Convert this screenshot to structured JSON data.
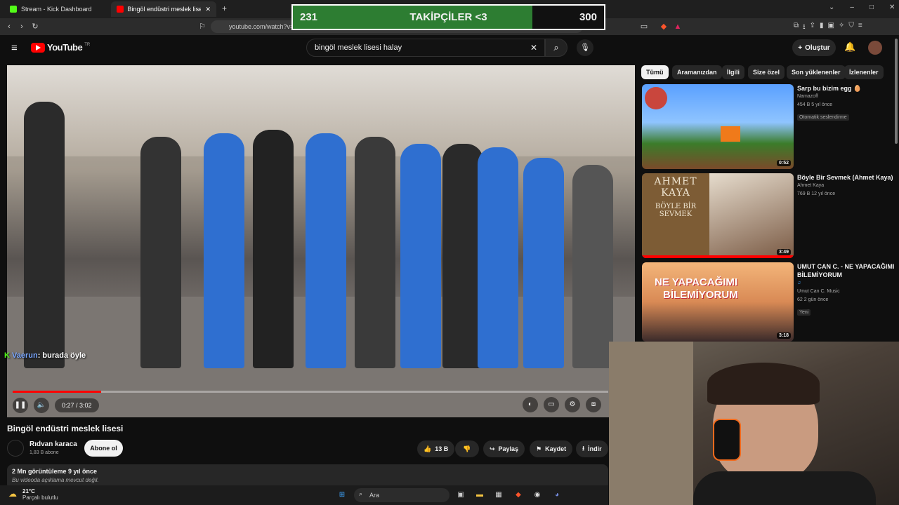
{
  "browser": {
    "tabs": [
      {
        "label": "Stream - Kick Dashboard",
        "color": "#53fc18"
      },
      {
        "label": "Bingöl endüstri meslek lisesi",
        "color": "#ff0000"
      }
    ],
    "url": "youtube.com/watch?v="
  },
  "overlay": {
    "left_count": "231",
    "label": "TAKİPÇİLER <3",
    "right_count": "300",
    "progress": 0.77,
    "fill_color": "#2d7d32"
  },
  "youtube": {
    "logo": "YouTube",
    "region": "TR",
    "search_query": "bingöl meslek lisesi halay",
    "create_label": "Oluştur"
  },
  "video": {
    "chat_user": "Vaerun",
    "chat_message": ": burada öyle",
    "time": "0:27 / 3:02",
    "progress": 0.149,
    "title": "Bingöl endüstri meslek lisesi",
    "channel": "Rıdvan karaca",
    "subscribers": "1,83 B abone",
    "subscribe_label": "Abone ol",
    "likes": "13 B",
    "share_label": "Paylaş",
    "save_label": "Kaydet",
    "download_label": "İndir",
    "stats": "2 Mn görüntüleme  9 yıl önce",
    "description": "Bu videoda açıklama mevcut değil."
  },
  "chips": [
    "Tümü",
    "Aramanızdan",
    "İlgili",
    "Size özel",
    "Son yüklenenler",
    "İzlenenler"
  ],
  "recommendations": [
    {
      "title": "Sarp bu bizim egg 🥚",
      "channel": "Namazoff",
      "meta": "454 B  5 yıl önce",
      "badge": "Otomatik seslendirme",
      "duration": "0:52"
    },
    {
      "title": "Böyle Bir Sevmek (Ahmet Kaya)",
      "channel": "Ahmet Kaya",
      "meta": "769 B  12 yıl önce",
      "duration": "3:49",
      "thumb_text_1": "AHMET",
      "thumb_text_2": "KAYA",
      "thumb_text_3": "BÖYLE BİR",
      "thumb_text_4": "SEVMEK"
    },
    {
      "title": "UMUT CAN C. - NE YAPACAĞIMI BİLEMİYORUM",
      "channel": "Umut Can C. Music",
      "meta": "62  2 gün önce",
      "badge": "Yeni",
      "duration": "3:18",
      "thumb_text_1": "NE YAPACAĞIMI",
      "thumb_text_2": "BİLEMİYORUM"
    }
  ],
  "taskbar": {
    "temp": "21°C",
    "weather": "Parçalı bulutlu",
    "search_placeholder": "Ara"
  }
}
